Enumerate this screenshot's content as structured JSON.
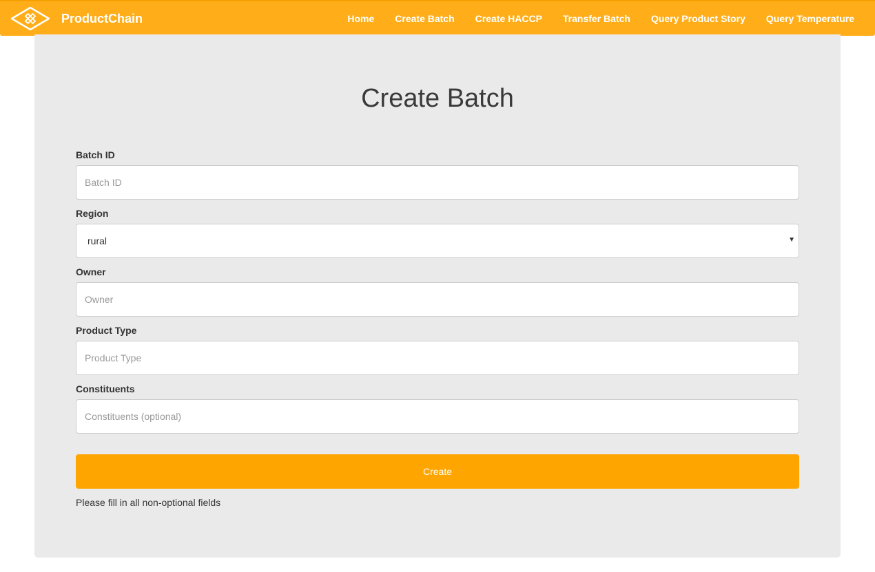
{
  "brand": {
    "name": "ProductChain",
    "logo_icon": "diamond-knot-logo-icon"
  },
  "nav": {
    "items": [
      {
        "label": "Home"
      },
      {
        "label": "Create Batch"
      },
      {
        "label": "Create HACCP"
      },
      {
        "label": "Transfer Batch"
      },
      {
        "label": "Query Product Story"
      },
      {
        "label": "Query Temperature"
      }
    ]
  },
  "form": {
    "title": "Create Batch",
    "batch_id": {
      "label": "Batch ID",
      "placeholder": "Batch ID",
      "value": ""
    },
    "region": {
      "label": "Region",
      "selected": "rural"
    },
    "owner": {
      "label": "Owner",
      "placeholder": "Owner",
      "value": ""
    },
    "product_type": {
      "label": "Product Type",
      "placeholder": "Product Type",
      "value": ""
    },
    "constituents": {
      "label": "Constituents",
      "placeholder": "Constituents (optional)",
      "value": ""
    },
    "submit_label": "Create",
    "hint": "Please fill in all non-optional fields"
  },
  "colors": {
    "navbar": "#ffae1a",
    "button": "#ffa500",
    "panel": "#eaeaea"
  }
}
